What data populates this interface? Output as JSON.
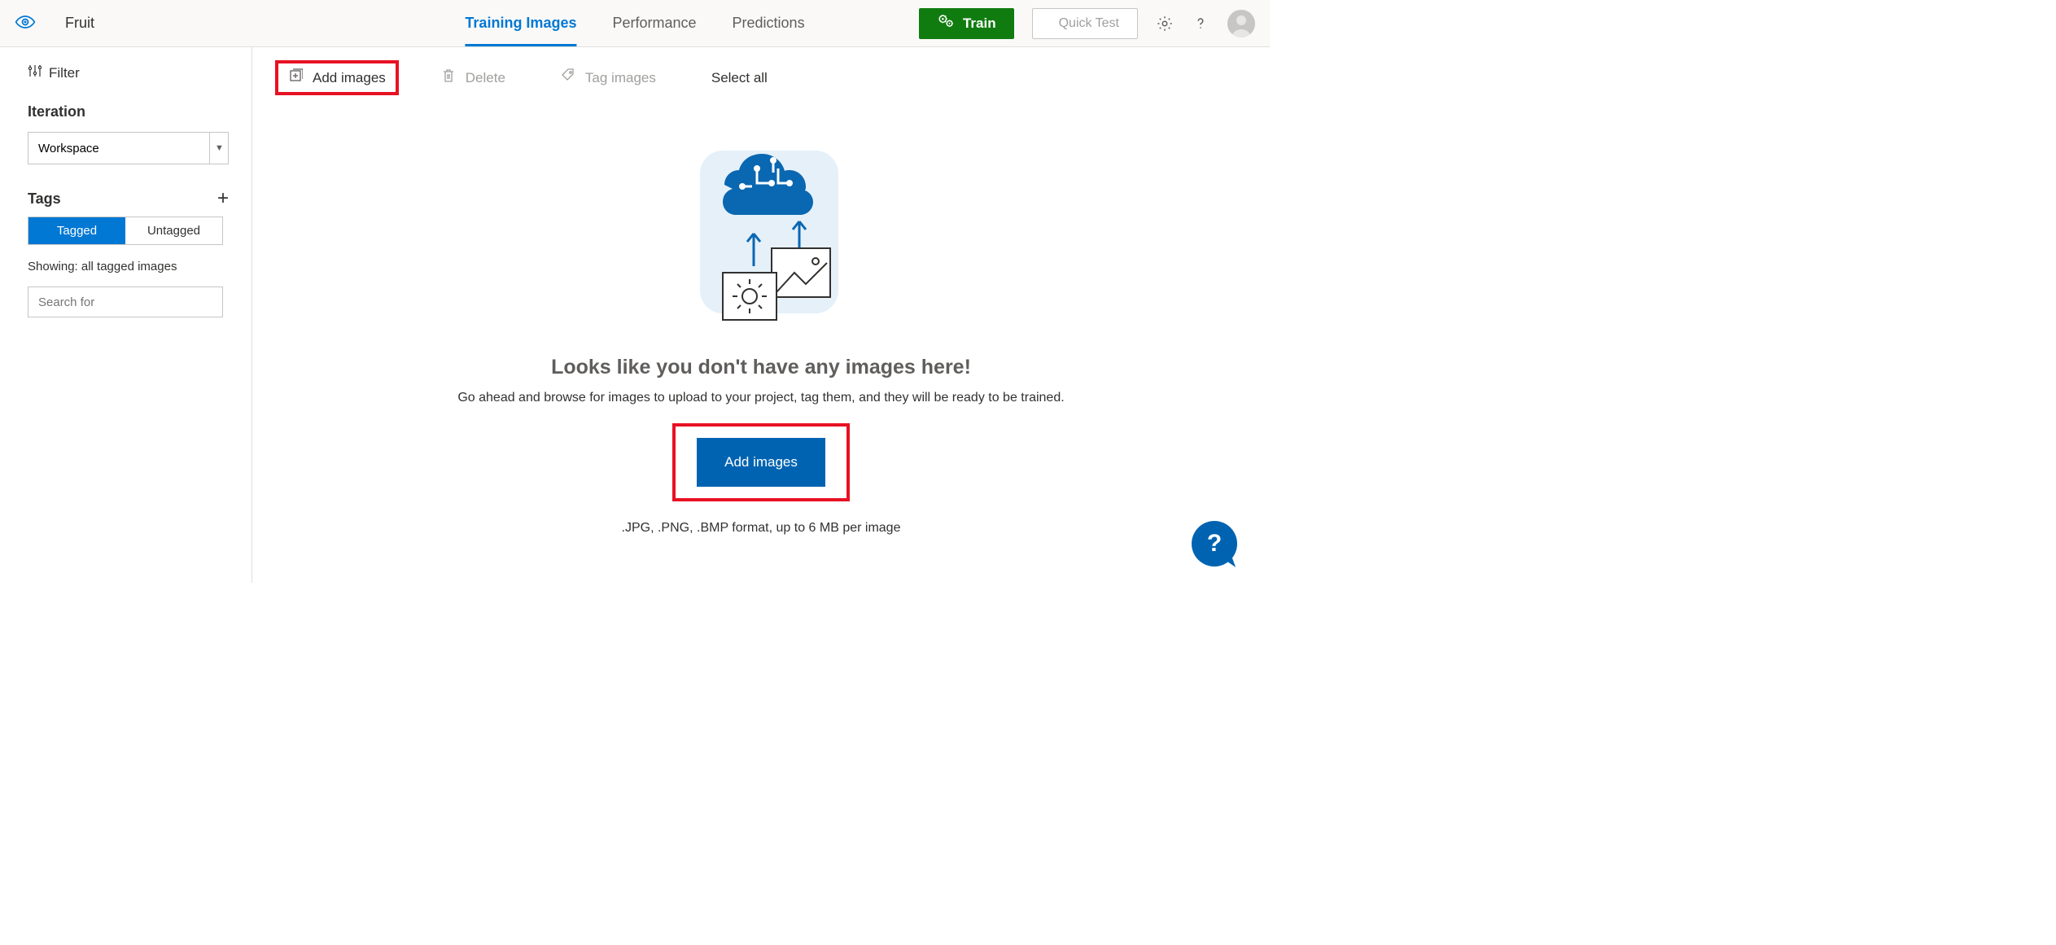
{
  "header": {
    "project_name": "Fruit",
    "tabs": [
      {
        "label": "Training Images",
        "active": true
      },
      {
        "label": "Performance",
        "active": false
      },
      {
        "label": "Predictions",
        "active": false
      }
    ],
    "train_label": "Train",
    "quick_test_label": "Quick Test"
  },
  "sidebar": {
    "filter_label": "Filter",
    "iteration_label": "Iteration",
    "iteration_selected": "Workspace",
    "tags_label": "Tags",
    "tag_toggle": {
      "tagged": "Tagged",
      "untagged": "Untagged",
      "active": "tagged"
    },
    "showing_text": "Showing: all tagged images",
    "search_placeholder": "Search for"
  },
  "toolbar": {
    "add_images": "Add images",
    "delete": "Delete",
    "tag_images": "Tag images",
    "select_all": "Select all"
  },
  "empty": {
    "title": "Looks like you don't have any images here!",
    "desc": "Go ahead and browse for images to upload to your project, tag them, and they will be ready to be trained.",
    "cta": "Add images",
    "format_hint": ".JPG, .PNG, .BMP format, up to 6 MB per image"
  },
  "help_fab": "?"
}
